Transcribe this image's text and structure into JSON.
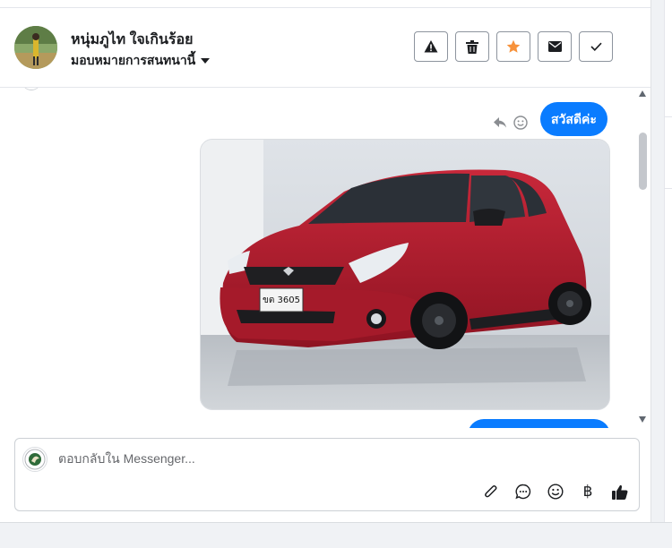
{
  "header": {
    "contact_name": "หนุ่มภูไท ใจเกินร้อย",
    "assign_label": "มอบหมายการสนทนานี้",
    "actions": [
      {
        "name": "spam-button",
        "icon": "warning-icon"
      },
      {
        "name": "delete-button",
        "icon": "trash-icon"
      },
      {
        "name": "star-button",
        "icon": "star-icon",
        "color": "#f7923b"
      },
      {
        "name": "mark-unread-button",
        "icon": "envelope-icon"
      },
      {
        "name": "mark-done-button",
        "icon": "check-icon"
      }
    ]
  },
  "conversation": {
    "messages": [
      {
        "type": "text",
        "text": "สวัสดีค่ะ",
        "color": "#0a7cff"
      },
      {
        "type": "image",
        "subject": "red hatchback car",
        "plate": "ขต 3605"
      }
    ]
  },
  "composer": {
    "placeholder": "ตอบกลับใน Messenger...",
    "value": "",
    "tools": [
      "attachment-icon",
      "saved-reply-icon",
      "emoji-icon",
      "baht-icon",
      "thumbs-up-icon"
    ],
    "baht_symbol": "฿"
  },
  "colors": {
    "accent": "#0a7cff",
    "star": "#f7923b",
    "border": "#ccd0d5"
  }
}
